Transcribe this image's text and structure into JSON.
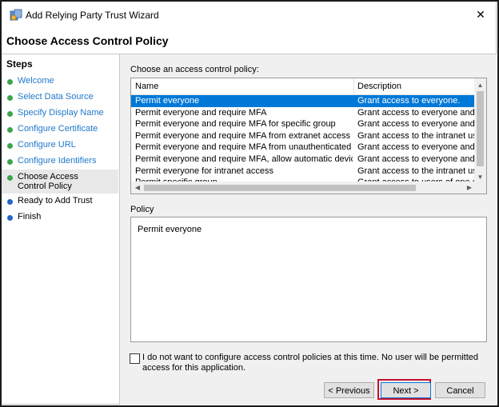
{
  "window": {
    "title": "Add Relying Party Trust Wizard",
    "close_glyph": "✕",
    "icon": "relying-party-trust-icon"
  },
  "header": {
    "page_title": "Choose Access Control Policy"
  },
  "steps": {
    "title": "Steps",
    "items": [
      {
        "label": "Welcome",
        "state": "done"
      },
      {
        "label": "Select Data Source",
        "state": "done"
      },
      {
        "label": "Specify Display Name",
        "state": "done"
      },
      {
        "label": "Configure Certificate",
        "state": "done"
      },
      {
        "label": "Configure URL",
        "state": "done"
      },
      {
        "label": "Configure Identifiers",
        "state": "done"
      },
      {
        "label": "Choose Access Control Policy",
        "state": "current"
      },
      {
        "label": "Ready to Add Trust",
        "state": "todo"
      },
      {
        "label": "Finish",
        "state": "todo"
      }
    ]
  },
  "policy_list": {
    "prompt": "Choose an access control policy:",
    "columns": {
      "name": "Name",
      "description": "Description"
    },
    "rows": [
      {
        "name": "Permit everyone",
        "description": "Grant access to everyone.",
        "selected": true
      },
      {
        "name": "Permit everyone and require MFA",
        "description": "Grant access to everyone and requir"
      },
      {
        "name": "Permit everyone and require MFA for specific group",
        "description": "Grant access to everyone and requir"
      },
      {
        "name": "Permit everyone and require MFA from extranet access",
        "description": "Grant access to the intranet users an"
      },
      {
        "name": "Permit everyone and require MFA from unauthenticated devices",
        "description": "Grant access to everyone and requir"
      },
      {
        "name": "Permit everyone and require MFA, allow automatic device registr...",
        "description": "Grant access to everyone and requir"
      },
      {
        "name": "Permit everyone for intranet access",
        "description": "Grant access to the intranet users."
      },
      {
        "name": "Permit specific group",
        "description": "Grant access to users of one or more"
      }
    ]
  },
  "policy": {
    "label": "Policy",
    "text": "Permit everyone"
  },
  "optout": {
    "checked": false,
    "text": "I do not want to configure access control policies at this time. No user will be permitted access for this application."
  },
  "buttons": {
    "previous": "< Previous",
    "next": "Next >",
    "cancel": "Cancel"
  },
  "colors": {
    "selection": "#0078d7",
    "step_done_dot": "#3ea34d",
    "step_todo_dot": "#2365c9",
    "step_link": "#1f79c9",
    "highlight": "#c8102e"
  }
}
